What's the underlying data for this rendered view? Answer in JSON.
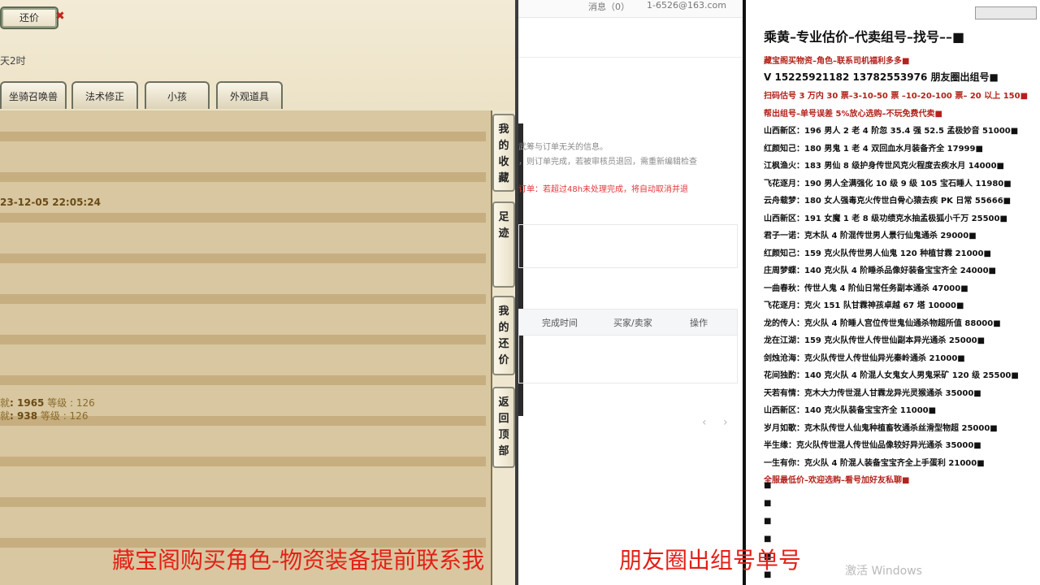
{
  "game": {
    "counter_button": "还价",
    "counter_close": "✖",
    "time_left": "天2时",
    "tabs": [
      "坐骑召唤兽",
      "法术修正",
      "小孩",
      "外观道具"
    ],
    "timestamp": "23-12-05 22:05:24",
    "achievements": [
      {
        "prefix": "就",
        "value_label": ": 1965",
        "grade": "等级 : 126"
      },
      {
        "prefix": "就",
        "value_label": ": 938",
        "grade": "等级 : 126"
      }
    ],
    "side_buttons": [
      "我的收藏",
      "足迹",
      "我的还价",
      "返回顶部"
    ]
  },
  "web": {
    "header_left": "消息（0）",
    "header_right": "1-6526@163.com",
    "notes": [
      "武筹与订单无关的信息。",
      "，则订单完成，若被审核员退回，需重新编辑检查"
    ],
    "warning": "订单：若超过48h未处理完成，将自动取消并退",
    "table_headers": [
      "完成时间",
      "买家/卖家",
      "操作"
    ],
    "pager_prev": "‹",
    "pager_next": "›"
  },
  "sale": {
    "title": "乘黄–专业估价–代卖组号–找号––■",
    "lines": [
      {
        "text": "藏宝阁买物资–角色–联系司机福利多多■",
        "color": "#b3221b"
      },
      {
        "text": "V 15225921182   13782553976 朋友圈出组号■",
        "color": "#111111"
      },
      {
        "text": "扫码估号 3 万内 30 票–3-10-50 票 –10-20-100 票– 20 以上 150■",
        "color": "#b3221b"
      },
      {
        "text": "帮出组号–单号误差 5%放心选购–不玩免费代卖■",
        "color": "#b3221b"
      },
      {
        "text": "山西新区：196 男人 2 老 4 阶忽 35.4 强 52.5 孟极妙音 51000■",
        "color": "#111111"
      },
      {
        "text": "红颜知己：180 男鬼 1 老 4 双回血水月装备齐全 17999■",
        "color": "#111111"
      },
      {
        "text": "江枫渔火：183 男仙 8 级护身传世风克火程度去疾水月 14000■",
        "color": "#111111"
      },
      {
        "text": "飞花逐月：190 男人全满强化 10 级 9 级 105 宝石睡人 11980■",
        "color": "#111111"
      },
      {
        "text": "云舟载梦：180 女人强毒克火传世白骨心猿去疾 PK 日常 55666■",
        "color": "#111111"
      },
      {
        "text": "山西新区：191 女魔 1 老 8 级功绩克水抽孟极狐小千万 25500■",
        "color": "#111111"
      },
      {
        "text": "君子一诺：克木队 4 阶混传世男人景行仙鬼通杀 29000■",
        "color": "#111111"
      },
      {
        "text": "红颜知己：159 克火队传世男人仙鬼 120 种植甘霖 21000■",
        "color": "#111111"
      },
      {
        "text": "庄周梦蝶：140 克火队 4 阶睡杀品像好装备宝宝齐全 24000■",
        "color": "#111111"
      },
      {
        "text": "一曲春秋：传世人鬼 4 阶仙日常任务副本通杀 47000■",
        "color": "#111111"
      },
      {
        "text": "飞花逐月：克火 151 队甘霖神孩卓越 67 塔 10000■",
        "color": "#111111"
      },
      {
        "text": "龙的传人：克火队 4 阶睡人宫位传世鬼仙通杀物超所值 88000■",
        "color": "#111111"
      },
      {
        "text": "龙在江湖：159 克火队传世人传世仙副本异光通杀 25000■",
        "color": "#111111"
      },
      {
        "text": "剑烛沧海：克火队传世人传世仙异光秦岭通杀 21000■",
        "color": "#111111"
      },
      {
        "text": "花间独酌：140 克火队 4 阶混人女鬼女人男鬼采矿 120 级 25500■",
        "color": "#111111"
      },
      {
        "text": "天若有情：克木大力传世混人甘霖龙异光灵猴通杀 35000■",
        "color": "#111111"
      },
      {
        "text": "山西新区：140 克火队装备宝宝齐全 11000■",
        "color": "#111111"
      },
      {
        "text": "岁月如歌：克木队传世人仙鬼种植畜牧通杀丝滑型物超 25000■",
        "color": "#111111"
      },
      {
        "text": "半生缘：克火队传世混人传世仙品像较好异光通杀 35000■",
        "color": "#111111"
      },
      {
        "text": "一生有你：克火队 4 阶混人装备宝宝齐全上手蛋利 21000■",
        "color": "#111111"
      },
      {
        "text": "全服最低价–欢迎选购–看号加好友私聊■",
        "color": "#b3221b"
      }
    ],
    "bullets": [
      "■",
      "■",
      "■",
      "■",
      "■",
      "■"
    ]
  },
  "caption": {
    "left": "藏宝阁购买角色-物资装备提前联系我",
    "right": "朋友圈出组号单号"
  },
  "watermark": "激活 Windows",
  "colors": {
    "caption_red": "#e42016",
    "sale_red": "#b3221b",
    "panel_tan": "#d8c7a0"
  }
}
